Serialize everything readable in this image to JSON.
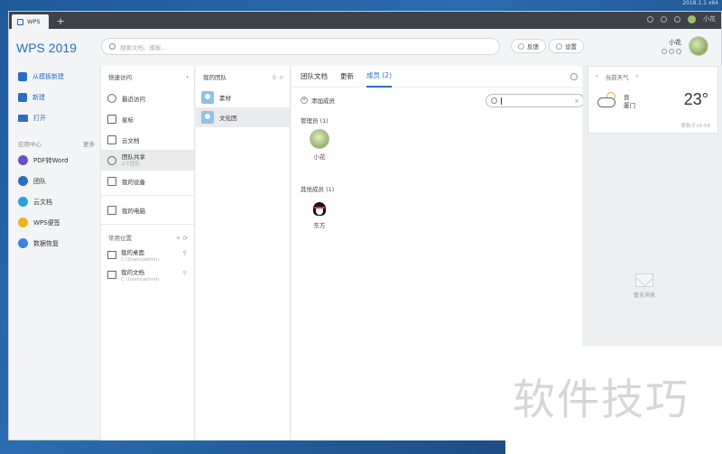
{
  "system": {
    "version": "2018.1.1 x64"
  },
  "tabbar": {
    "tab_label": "WPS",
    "add_tab": "+",
    "account_name": "小花"
  },
  "header": {
    "brand": "WPS 2019",
    "search_placeholder": "搜索文档、模板…",
    "feedback": "反馈",
    "settings": "设置",
    "user_name": "小花"
  },
  "sidebar": {
    "new_from_template": "从模板新建",
    "new": "新建",
    "open": "打开",
    "app_center": "应用中心",
    "more": "更多",
    "apps": [
      {
        "label": "PDF转Word",
        "color": "#6a4fc8"
      },
      {
        "label": "团队",
        "color": "#2b6cc4"
      },
      {
        "label": "云文档",
        "color": "#2b9fd8"
      },
      {
        "label": "WPS便签",
        "color": "#f1b21a"
      },
      {
        "label": "数据恢复",
        "color": "#3d82e0"
      }
    ]
  },
  "quick": {
    "title": "快速访问",
    "items": [
      {
        "label": "最近访问"
      },
      {
        "label": "星标"
      },
      {
        "label": "云文档"
      },
      {
        "label": "团队共享",
        "sub": "2个团队"
      },
      {
        "label": "我的设备"
      },
      {
        "label": "我的电脑"
      }
    ],
    "common_title": "常用位置",
    "common": [
      {
        "label": "我的桌面",
        "path": "C:\\Users\\admin"
      },
      {
        "label": "我的文档",
        "path": "C:\\Users\\admin"
      }
    ]
  },
  "teams": {
    "title": "我的团队",
    "items": [
      {
        "label": "素材"
      },
      {
        "label": "文化团"
      }
    ]
  },
  "main": {
    "tabs": [
      "团队文档",
      "更新",
      "成员 (2)"
    ],
    "add_member": "添加成员",
    "search_value": "",
    "admins_label": "管理员 (1)",
    "admin_name": "小花",
    "others_label": "其他成员 (1)",
    "other_name": "东方"
  },
  "weather": {
    "title": "当前天气",
    "condition": "良",
    "city": "厦门",
    "temp": "23°",
    "updated": "更新于10:58"
  },
  "empty": {
    "text": "暂无消息"
  },
  "watermark": "软件技巧"
}
